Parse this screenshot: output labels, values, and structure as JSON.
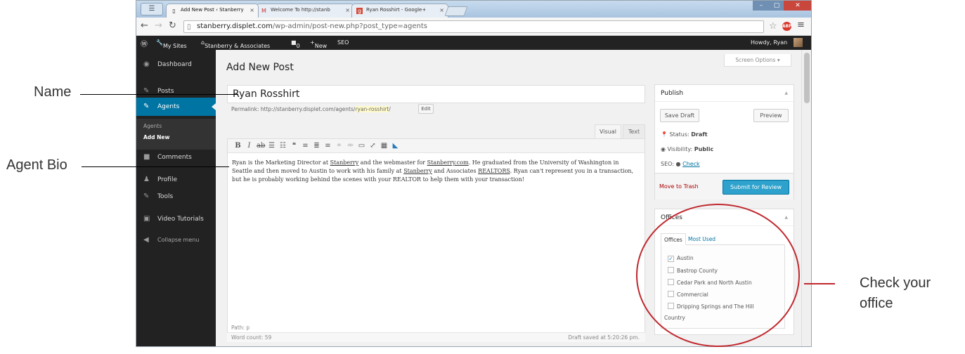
{
  "browser": {
    "tabs": [
      {
        "title": "Add New Post ‹ Stanberry",
        "favicon": "page-icon"
      },
      {
        "title": "Welcome To http://stanb",
        "favicon": "gmail-icon"
      },
      {
        "title": "Ryan Rosshirt - Google+",
        "favicon": "google-plus-icon"
      }
    ],
    "tab_close": "×",
    "url_host": "stanberry.displet.com",
    "url_path": "/wp-admin/post-new.php?post_type=agents"
  },
  "adminbar": {
    "wp_logo": "wordpress-icon",
    "my_sites": "My Sites",
    "site_name": "Stanberry & Associates",
    "comments_count": "0",
    "new": "New",
    "seo": "SEO",
    "howdy": "Howdy, Ryan"
  },
  "sidebar": {
    "items": [
      {
        "label": "Dashboard",
        "icon": "dashboard-icon"
      },
      {
        "label": "Posts",
        "icon": "pin-icon"
      },
      {
        "label": "Agents",
        "icon": "pin-icon"
      },
      {
        "label": "Comments",
        "icon": "comment-icon"
      },
      {
        "label": "Profile",
        "icon": "user-icon"
      },
      {
        "label": "Tools",
        "icon": "wrench-icon"
      },
      {
        "label": "Video Tutorials",
        "icon": "video-icon"
      },
      {
        "label": "Collapse menu",
        "icon": "collapse-icon"
      }
    ],
    "submenu": [
      "Agents",
      "Add New"
    ],
    "active_color": "#0074a2"
  },
  "main": {
    "page_title": "Add New Post",
    "screen_options": "Screen Options",
    "post_title": "Ryan Rosshirt",
    "permalink_label": "Permalink:",
    "permalink_base": "http://stanberry.displet.com/agents/",
    "permalink_slug": "ryan-rosshirt",
    "permalink_end": "/",
    "edit_label": "Edit",
    "tab_visual": "Visual",
    "tab_text": "Text",
    "bio_parts": [
      "Ryan is the Marketing Director at ",
      "Stanberry",
      " and the webmaster for ",
      "Stanberry.com",
      ". He graduated from the University of Washington in Seattle and then moved to Austin to work with his family at ",
      "Stanberry",
      " and Associates ",
      "REALTORS",
      ". Ryan can't represent you in a transaction, but he is probably working behind the scenes with your REALTOR to help them with your transaction!"
    ],
    "path": "Path: p",
    "word_count": "Word count: 59",
    "draft_saved": "Draft saved at 5:20:26 pm."
  },
  "publish": {
    "title": "Publish",
    "save_draft": "Save Draft",
    "preview": "Preview",
    "status_label": "Status:",
    "status_value": "Draft",
    "visibility_label": "Visibility:",
    "visibility_value": "Public",
    "seo_label": "SEO:",
    "seo_link": "Check",
    "move_to_trash": "Move to Trash",
    "submit": "Submit for Review",
    "primary_color": "#2ea2cc"
  },
  "offices": {
    "title": "Offices",
    "tab_all": "Offices",
    "tab_most_used": "Most Used",
    "items": [
      {
        "label": "Austin",
        "checked": true
      },
      {
        "label": "Bastrop County",
        "checked": false
      },
      {
        "label": "Cedar Park and North Austin",
        "checked": false
      },
      {
        "label": "Commercial",
        "checked": false
      },
      {
        "label": "Dripping Springs and The Hill",
        "checked": false
      }
    ],
    "wrap_text": "Country"
  },
  "annotations": {
    "name": "Name",
    "agent_bio": "Agent Bio",
    "check_office_line1": "Check your",
    "check_office_line2": "office",
    "highlight_color": "#c0282e"
  }
}
